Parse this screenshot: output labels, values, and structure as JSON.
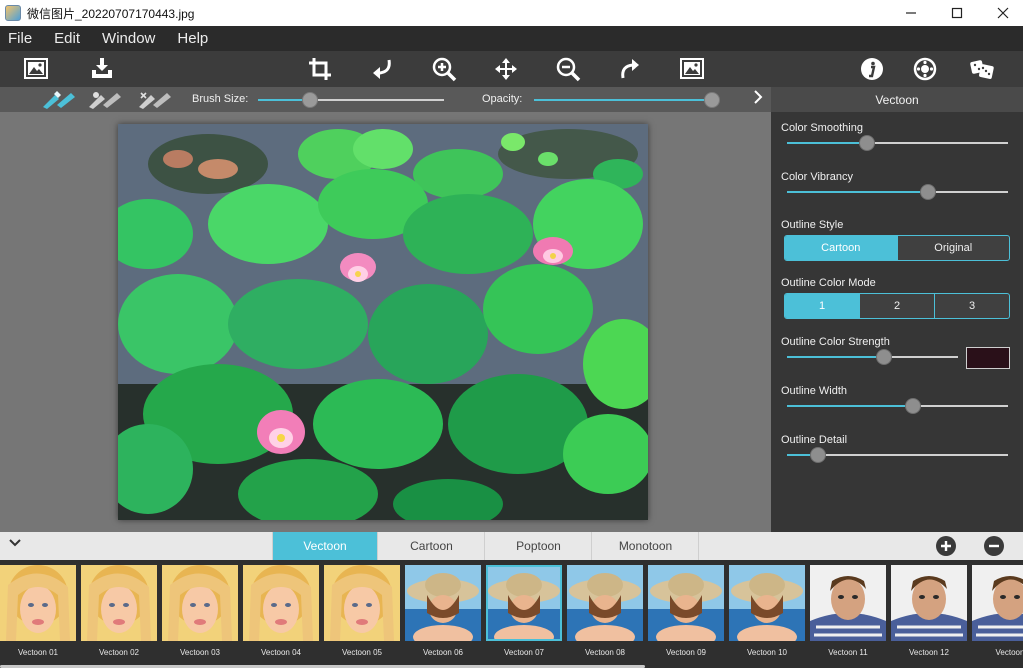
{
  "window": {
    "title": "微信图片_20220707170443.jpg",
    "minimize": "—",
    "maximize": "☐",
    "close": "✕"
  },
  "menu": [
    "File",
    "Edit",
    "Window",
    "Help"
  ],
  "brushbar": {
    "brush_size_label": "Brush Size:",
    "brush_size_value": 0.28,
    "opacity_label": "Opacity:",
    "opacity_value": 1.0
  },
  "panel": {
    "title": "Vectoon",
    "color_smoothing": {
      "label": "Color Smoothing",
      "value": 0.36
    },
    "color_vibrancy": {
      "label": "Color Vibrancy",
      "value": 0.64
    },
    "outline_style": {
      "label": "Outline Style",
      "options": [
        "Cartoon",
        "Original"
      ],
      "selected": 0
    },
    "outline_color_mode": {
      "label": "Outline Color Mode",
      "options": [
        "1",
        "2",
        "3"
      ],
      "selected": 0
    },
    "outline_color_strength": {
      "label": "Outline Color Strength",
      "value": 0.57,
      "color": "#2a1019"
    },
    "outline_width": {
      "label": "Outline Width",
      "value": 0.57
    },
    "outline_detail": {
      "label": "Outline Detail",
      "value": 0.14
    }
  },
  "tabs": {
    "labels": [
      "Vectoon",
      "Cartoon",
      "Poptoon",
      "Monotoon"
    ],
    "active": 0
  },
  "thumbnails": [
    {
      "label": "Vectoon 01",
      "kind": "blonde"
    },
    {
      "label": "Vectoon 02",
      "kind": "blonde"
    },
    {
      "label": "Vectoon 03",
      "kind": "blonde"
    },
    {
      "label": "Vectoon 04",
      "kind": "blonde"
    },
    {
      "label": "Vectoon 05",
      "kind": "blonde"
    },
    {
      "label": "Vectoon 06",
      "kind": "hat"
    },
    {
      "label": "Vectoon 07",
      "kind": "hat"
    },
    {
      "label": "Vectoon 08",
      "kind": "hat"
    },
    {
      "label": "Vectoon 09",
      "kind": "hat"
    },
    {
      "label": "Vectoon 10",
      "kind": "hat"
    },
    {
      "label": "Vectoon 11",
      "kind": "man"
    },
    {
      "label": "Vectoon 12",
      "kind": "man"
    },
    {
      "label": "Vectoon",
      "kind": "man"
    }
  ],
  "selected_thumbnail": 6,
  "colors": {
    "accent": "#4cc0d8",
    "panel": "#363636",
    "canvas": "#767676",
    "toolbar": "#3c3c3c"
  },
  "icons": {
    "toolbar_left": [
      "open-image-icon",
      "save-image-icon"
    ],
    "toolbar_center": [
      "crop-icon",
      "rotate-left-icon",
      "zoom-in-icon",
      "move-icon",
      "zoom-out-icon",
      "rotate-right-icon",
      "fit-image-icon"
    ],
    "toolbar_right": [
      "info-icon",
      "settings-icon",
      "random-icon"
    ],
    "brush_tools": [
      "brush-blue-icon",
      "brush-gray-icon",
      "brush-eraser-icon"
    ]
  }
}
